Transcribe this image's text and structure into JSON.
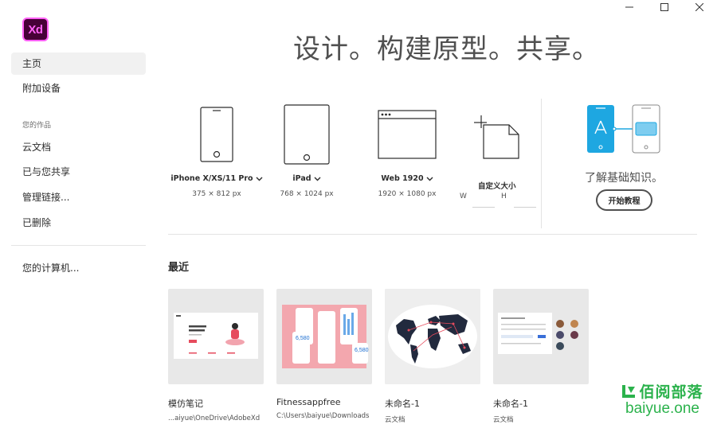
{
  "app": {
    "logo_text": "Xd",
    "logo_color": "#ff61f6",
    "logo_bg": "#470137"
  },
  "window_controls": [
    "minimize-icon",
    "maximize-icon",
    "close-icon"
  ],
  "sidebar": {
    "home": "主页",
    "add_device": "附加设备",
    "your_work": "您的作品",
    "cloud_docs": "云文档",
    "shared": "已与您共享",
    "manage_links": "管理链接...",
    "deleted": "已删除",
    "your_computer": "您的计算机..."
  },
  "hero": {
    "title": "设计。构建原型。共享。"
  },
  "presets": [
    {
      "name": "iPhone X/XS/11 Pro",
      "size": "375 × 812 px"
    },
    {
      "name": "iPad",
      "size": "768 × 1024 px"
    },
    {
      "name": "Web 1920",
      "size": "1920 × 1080 px"
    }
  ],
  "custom": {
    "label": "自定义大小",
    "w": "W",
    "h": "H"
  },
  "learn": {
    "title": "了解基础知识。",
    "button": "开始教程"
  },
  "recent": {
    "title": "最近",
    "items": [
      {
        "name": "模仿笔记",
        "path": "...aiyue\\OneDrive\\AdobeXd"
      },
      {
        "name": "Fitnessappfree",
        "path": "C:\\Users\\baiyue\\Downloads"
      },
      {
        "name": "未命名-1",
        "path": "云文档"
      },
      {
        "name": "未命名-1",
        "path": "云文档"
      }
    ]
  },
  "thumb_fitness": {
    "stat": "6,580"
  },
  "watermark": {
    "cn": "佰阅部落",
    "en": "baiyue.one",
    "color": "#2bb24c"
  }
}
